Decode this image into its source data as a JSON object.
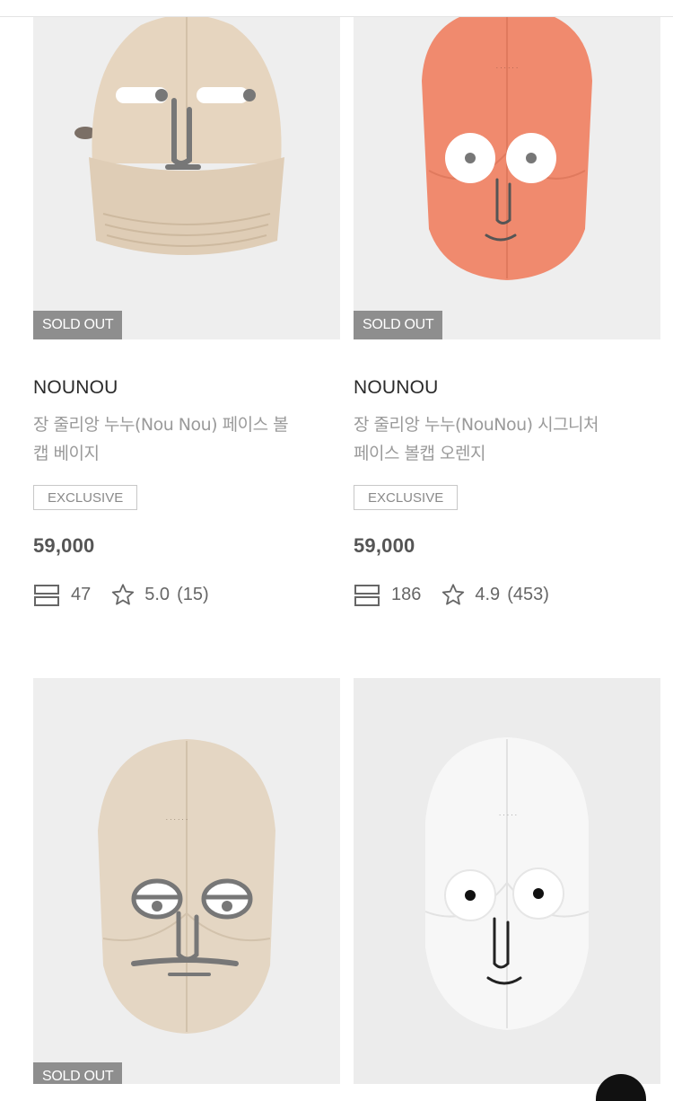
{
  "products": [
    {
      "brand": "NOUNOU",
      "title_line1": "장 줄리앙 누누(Nou Nou) 페이스 볼",
      "title_line2": "캡 베이지",
      "badge": "EXCLUSIVE",
      "price": "59,000",
      "stock_count": "47",
      "rating": "5.0",
      "review_count": "(15)",
      "status": "SOLD OUT",
      "cap_color": "#e6d5bf"
    },
    {
      "brand": "NOUNOU",
      "title_line1": "장 줄리앙 누누(NouNou) 시그니처",
      "title_line2": "페이스 볼캡 오렌지",
      "badge": "EXCLUSIVE",
      "price": "59,000",
      "stock_count": "186",
      "rating": "4.9",
      "review_count": "(453)",
      "status": "SOLD OUT",
      "cap_color": "#f08a6e"
    },
    {
      "status": "SOLD OUT",
      "cap_color": "#e4d6c3"
    },
    {
      "cap_color": "#f7f7f7"
    }
  ],
  "icons": {
    "stock": "list-icon",
    "rating": "star-outline-icon"
  }
}
